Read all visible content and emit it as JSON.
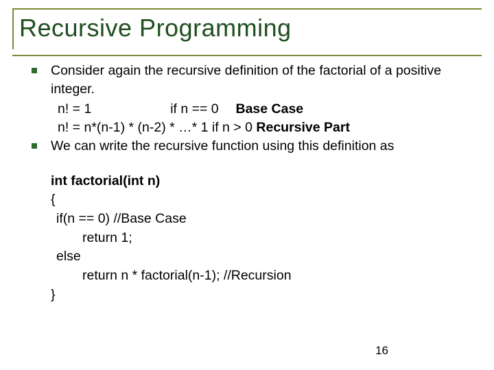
{
  "title": "Recursive Programming",
  "bullets": {
    "b1_text": "Consider again the recursive definition of the factorial of a positive integer.",
    "b1_sub1_a": "n! = 1",
    "b1_sub1_b": "if n == 0",
    "b1_sub1_c": "Base Case",
    "b1_sub2_a": "n! = n*(n-1) * (n-2) * …* 1  if n > 0 ",
    "b1_sub2_b": "Recursive Part",
    "b2_text": "We can write the recursive function using this definition as"
  },
  "code": {
    "l1": "int factorial(int n)",
    "l2": "{",
    "l3": "if(n == 0)  //Base Case",
    "l4": "return 1;",
    "l5": "else",
    "l6": "return  n * factorial(n-1);   //Recursion",
    "l7": "}"
  },
  "page_number": "16"
}
